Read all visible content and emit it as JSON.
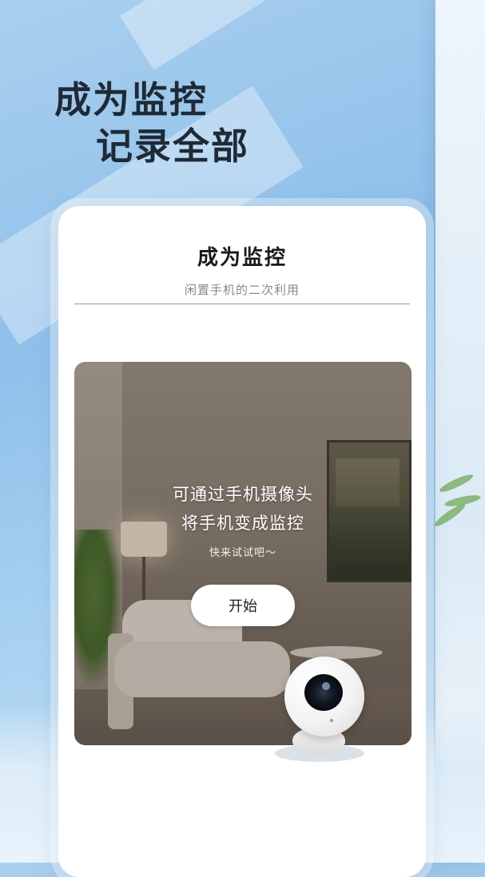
{
  "headline": {
    "line1": "成为监控",
    "line2": "记录全部"
  },
  "card": {
    "title": "成为监控",
    "subtitle": "闲置手机的二次利用"
  },
  "hero": {
    "line1": "可通过手机摄像头",
    "line2": "将手机变成监控",
    "hint": "快来试试吧～",
    "start_label": "开始"
  },
  "icons": {
    "camera": "security-camera-icon"
  },
  "colors": {
    "background": "#9cc8ec",
    "card": "#ffffff",
    "headline_text": "#1f2a36",
    "button": "#ffffff"
  }
}
